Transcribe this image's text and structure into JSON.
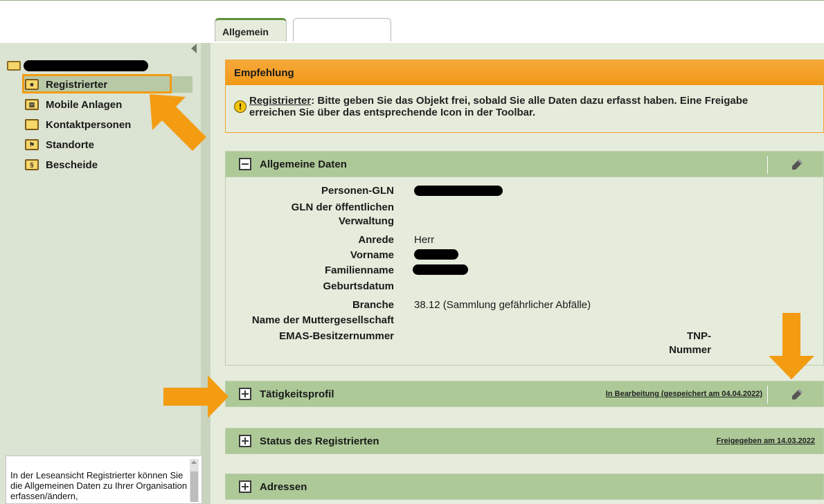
{
  "tabs": [
    {
      "label": "Allgemein",
      "active": true
    },
    {
      "label": "",
      "active": false
    }
  ],
  "tree": {
    "root_label": "[redacted] (…)",
    "items": [
      {
        "label": "Registrierter",
        "icon": "person-card-icon",
        "selected": true
      },
      {
        "label": "Mobile Anlagen",
        "icon": "vehicle-icon",
        "selected": false
      },
      {
        "label": "Kontaktpersonen",
        "icon": "folder-icon",
        "selected": false
      },
      {
        "label": "Standorte",
        "icon": "pin-icon",
        "selected": false
      },
      {
        "label": "Bescheide",
        "icon": "paragraph-icon",
        "selected": false
      }
    ]
  },
  "help_text": "In der Leseansicht Registrierter können Sie die Allgemeinen Daten zu Ihrer Organisation erfassen/ändern,",
  "recommendation": {
    "title": "Empfehlung",
    "link": "Registrierter",
    "text_1": ": Bitte geben Sie das Objekt frei, sobald Sie alle Daten dazu erfasst haben. Eine Freigabe",
    "text_2": "erreichen Sie über das entsprechende Icon in der Toolbar."
  },
  "general_data": {
    "title": "Allgemeine Daten",
    "fields": [
      {
        "label": "Personen-GLN",
        "value": "[redacted]"
      },
      {
        "label": "GLN der öffentlichen Verwaltung",
        "value": ""
      },
      {
        "label": "Anrede",
        "value": "Herr"
      },
      {
        "label": "Vorname",
        "value": "[redacted]"
      },
      {
        "label": "Familienname",
        "value": "[redacted]"
      },
      {
        "label": "Geburtsdatum",
        "value": ""
      },
      {
        "label": "Branche",
        "value": "38.12 (Sammlung gefährlicher Abfälle)"
      },
      {
        "label": "Name der Muttergesellschaft",
        "value": ""
      },
      {
        "label": "EMAS-Besitzernummer",
        "value": ""
      },
      {
        "label": "TNP-Nummer",
        "value": ""
      }
    ],
    "gln_label_1": "GLN der öffentlichen",
    "gln_label_2": "Verwaltung",
    "tnp_label_1": "TNP-",
    "tnp_label_2": "Nummer"
  },
  "sections": [
    {
      "title": "Tätigkeitsprofil",
      "status": "In Bearbeitung (gespeichert am 04.04.2022)"
    },
    {
      "title": "Status des Registrierten",
      "status": "Freigegeben am 14.03.2022"
    },
    {
      "title": "Adressen",
      "status": ""
    }
  ],
  "colors": {
    "accent_orange": "#f39c12",
    "section_green": "#adc997",
    "panel_bg": "#e6ecdc"
  }
}
